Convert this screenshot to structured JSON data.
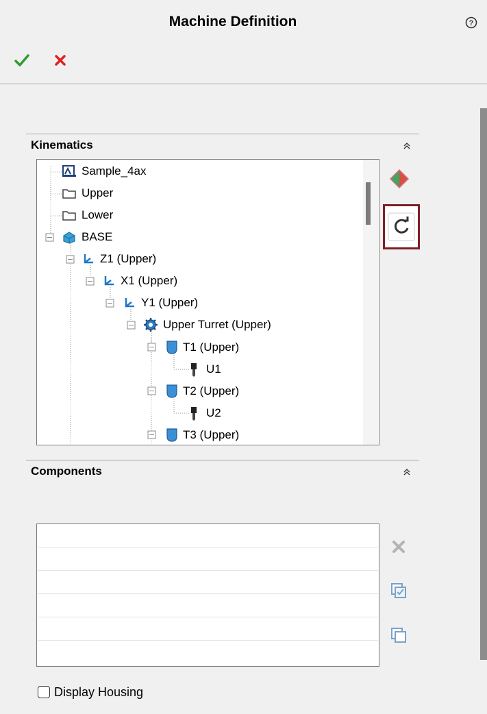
{
  "window": {
    "title": "Machine Definition"
  },
  "toolbar": {
    "ok_icon": "check-icon",
    "cancel_icon": "close-icon",
    "help_icon": "help-icon"
  },
  "kinematics": {
    "title": "Kinematics",
    "tree": [
      {
        "label": "Sample_4ax",
        "icon": "machine-icon",
        "level": 0
      },
      {
        "label": "Upper",
        "icon": "folder-icon",
        "level": 0
      },
      {
        "label": "Lower",
        "icon": "folder-icon",
        "level": 0
      },
      {
        "label": "BASE",
        "icon": "base-component-icon",
        "level": 0,
        "expanded": true
      },
      {
        "label": "Z1 (Upper)",
        "icon": "axis-icon",
        "level": 1,
        "expanded": true
      },
      {
        "label": "X1 (Upper)",
        "icon": "axis-icon",
        "level": 2,
        "expanded": true
      },
      {
        "label": "Y1 (Upper)",
        "icon": "axis-icon",
        "level": 3,
        "expanded": true
      },
      {
        "label": "Upper Turret (Upper)",
        "icon": "turret-gear-icon",
        "level": 4,
        "expanded": true
      },
      {
        "label": "T1 (Upper)",
        "icon": "tool-holder-icon",
        "level": 5,
        "expanded": true
      },
      {
        "label": "U1",
        "icon": "tool-icon",
        "level": 6
      },
      {
        "label": "T2 (Upper)",
        "icon": "tool-holder-icon",
        "level": 5,
        "expanded": true
      },
      {
        "label": "U2",
        "icon": "tool-icon",
        "level": 6
      },
      {
        "label": "T3 (Upper)",
        "icon": "tool-holder-icon",
        "level": 5,
        "expanded": true
      }
    ],
    "side_buttons": [
      "add-kinematic-icon",
      "refresh-icon"
    ]
  },
  "components": {
    "title": "Components",
    "rows": 6,
    "side_buttons": [
      "delete-icon",
      "select-all-icon",
      "deselect-icon"
    ]
  },
  "display_housing": {
    "label": "Display Housing",
    "checked": false
  },
  "colors": {
    "highlight_border": "#7f1d24",
    "ok_green": "#2e9e2e",
    "cancel_red": "#e02020",
    "tree_icon_blue": "#1f78c8"
  }
}
